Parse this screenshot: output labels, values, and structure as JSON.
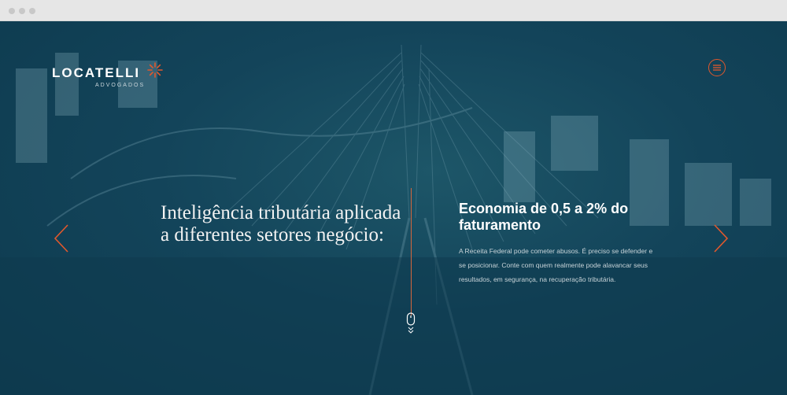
{
  "brand": {
    "name": "LOCATELLI",
    "subtitle": "ADVOGADOS",
    "accent": "#e2582c"
  },
  "icons": {
    "logo_mark": "sunburst-icon",
    "menu": "hamburger-icon",
    "prev": "chevron-left-icon",
    "next": "chevron-right-icon",
    "scroll": "mouse-scroll-icon"
  },
  "hero": {
    "headline": "Inteligência tributária aplicada a diferentes setores negócio:",
    "feature_title": "Economia de 0,5 a 2% do faturamento",
    "feature_body": "A Receita Federal pode cometer abusos. É preciso se defender e se posicionar. Conte com quem realmente pode alavancar seus resultados, em segurança, na recuperação tributária."
  },
  "colors": {
    "background": "#13445a",
    "text": "#ffffff"
  }
}
